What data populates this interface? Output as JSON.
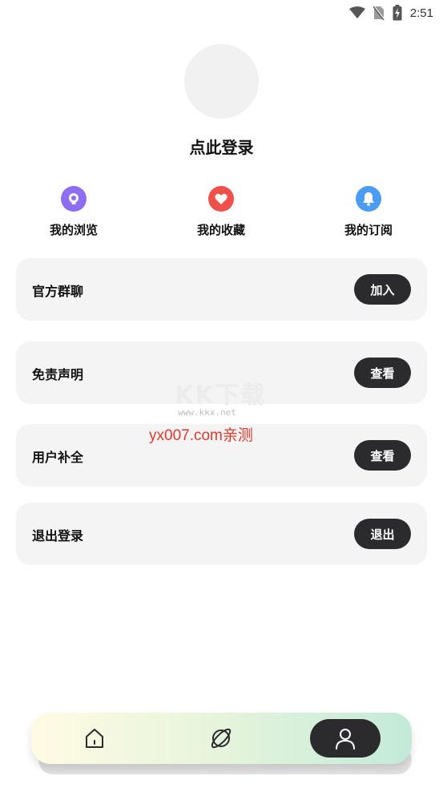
{
  "status_bar": {
    "time": "2:51"
  },
  "profile": {
    "login_text": "点此登录"
  },
  "quick_actions": [
    {
      "label": "我的浏览",
      "icon": "history-icon",
      "color": "#8e6df2"
    },
    {
      "label": "我的收藏",
      "icon": "heart-icon",
      "color": "#f0504a"
    },
    {
      "label": "我的订阅",
      "icon": "bell-icon",
      "color": "#4a9cf5"
    }
  ],
  "menu": [
    {
      "title": "官方群聊",
      "button": "加入"
    },
    {
      "title": "免责声明",
      "button": "查看"
    },
    {
      "title": "用户补全",
      "button": "查看"
    },
    {
      "title": "退出登录",
      "button": "退出"
    }
  ],
  "watermark": {
    "brand": "KK下载",
    "url": "www.kkx.net",
    "promo": "yx007.com亲测"
  },
  "tabbar": {
    "items": [
      "home-icon",
      "planet-icon",
      "user-icon"
    ],
    "active": "user-icon"
  }
}
